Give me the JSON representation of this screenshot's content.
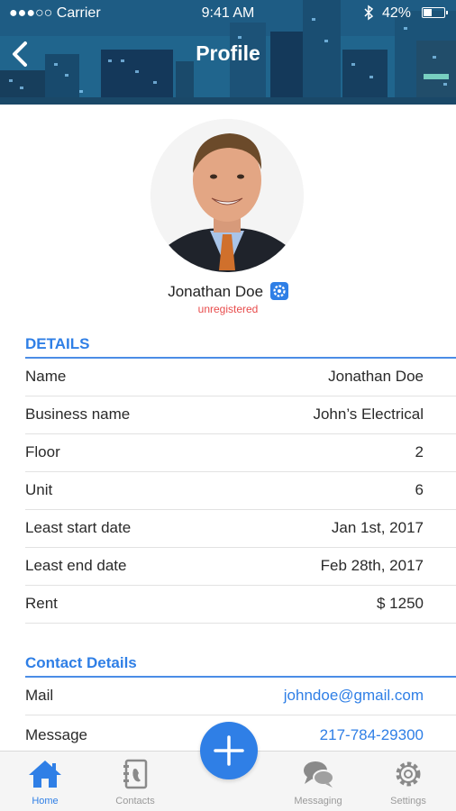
{
  "status_bar": {
    "carrier": "●●●○○ Carrier",
    "time": "9:41 AM",
    "battery": "42%",
    "battery_level": 0.42
  },
  "header": {
    "title": "Profile",
    "back_icon": "chevron-left-icon"
  },
  "profile": {
    "name": "Jonathan Doe",
    "status": "unregistered",
    "verified_icon": "gear-badge-icon"
  },
  "details": {
    "heading": "DETAILS",
    "rows": [
      {
        "label": "Name",
        "value": "Jonathan Doe"
      },
      {
        "label": "Business name",
        "value": "John’s Electrical"
      },
      {
        "label": "Floor",
        "value": "2"
      },
      {
        "label": "Unit",
        "value": "6"
      },
      {
        "label": "Least start date",
        "value": "Jan 1st, 2017"
      },
      {
        "label": "Least end date",
        "value": "Feb 28th, 2017"
      },
      {
        "label": "Rent",
        "value": "$ 1250"
      }
    ]
  },
  "contact": {
    "heading": "Contact Details",
    "rows": [
      {
        "label": "Mail",
        "value": "johndoe@gmail.com"
      },
      {
        "label": "Message",
        "value": "217-784-29300"
      }
    ]
  },
  "tabbar": {
    "tabs": [
      {
        "label": "Home",
        "icon": "home-icon",
        "active": true
      },
      {
        "label": "Contacts",
        "icon": "contacts-book-icon",
        "active": false
      },
      {
        "label": "Messaging",
        "icon": "chat-bubbles-icon",
        "active": false
      },
      {
        "label": "Settings",
        "icon": "gear-icon",
        "active": false
      }
    ],
    "fab_icon": "plus-icon"
  },
  "colors": {
    "accent": "#2f7fe6",
    "status_red": "#e84c4c",
    "header_bg": "#1f5a80"
  }
}
